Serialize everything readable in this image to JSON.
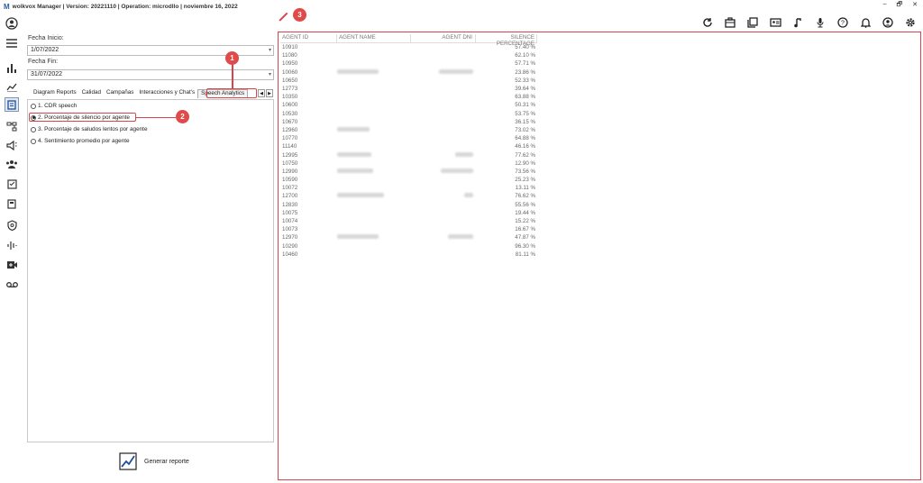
{
  "window": {
    "logo": "M",
    "title": "wolkvox Manager  | Version: 20221110 |  Operation: microdllo | noviembre 16, 2022",
    "controls": [
      "–",
      "🗗",
      "✕"
    ]
  },
  "toolbar": {
    "icons": [
      "refresh-icon",
      "toolbox-icon",
      "book-icon",
      "contact-card-icon",
      "music-note-icon",
      "microphone-icon",
      "help-icon",
      "bell-icon",
      "user-icon",
      "settings-icon"
    ]
  },
  "sidebar": {
    "icons": [
      "user-icon",
      "menu-icon",
      "bar-chart-icon",
      "trend-icon",
      "report-icon",
      "hierarchy-icon",
      "campaign-icon",
      "group-icon",
      "checklist-icon",
      "calculator-icon",
      "shield-icon",
      "audio-wave-icon",
      "video-icon",
      "voicemail-icon"
    ]
  },
  "filters": {
    "start_label": "Fecha Inicio:",
    "start_value": "1/07/2022",
    "end_label": "Fecha Fin:",
    "end_value": "31/07/2022"
  },
  "tabs": [
    "Diagram Reports",
    "Calidad",
    "Campañas",
    "Interacciones y Chat's",
    "Speech Analytics"
  ],
  "selected_tab": "Speech Analytics",
  "reports": [
    {
      "label": "1. CDR speech",
      "selected": false
    },
    {
      "label": "2. Porcentaje de silencio por agente",
      "selected": true
    },
    {
      "label": "3. Porcentaje de saludos lentos por agente",
      "selected": false
    },
    {
      "label": "4. Sentimiento promedio por agente",
      "selected": false
    }
  ],
  "generate_label": "Generar reporte",
  "table": {
    "headers": [
      "AGENT ID",
      "AGENT NAME",
      "AGENT DNI",
      "SILENCE PERCENTAGE"
    ],
    "rows": [
      [
        "10910",
        "57.40 %"
      ],
      [
        "11080",
        "62.10 %"
      ],
      [
        "10950",
        "57.71 %"
      ],
      [
        "10060",
        "23.86 %"
      ],
      [
        "10650",
        "52.33 %"
      ],
      [
        "12773",
        "39.64 %"
      ],
      [
        "10350",
        "63.88 %"
      ],
      [
        "10600",
        "50.31 %"
      ],
      [
        "10530",
        "53.75 %"
      ],
      [
        "10670",
        "36.15 %"
      ],
      [
        "12960",
        "73.02 %"
      ],
      [
        "10770",
        "64.88 %"
      ],
      [
        "11140",
        "46.16 %"
      ],
      [
        "12995",
        "77.62 %"
      ],
      [
        "10750",
        "12.90 %"
      ],
      [
        "12990",
        "73.56 %"
      ],
      [
        "10590",
        "25.23 %"
      ],
      [
        "10072",
        "13.11 %"
      ],
      [
        "12700",
        "76.62 %"
      ],
      [
        "12830",
        "55.56 %"
      ],
      [
        "10075",
        "19.44 %"
      ],
      [
        "10074",
        "15.22 %"
      ],
      [
        "10073",
        "16.67 %"
      ],
      [
        "12970",
        "47.87 %"
      ],
      [
        "10290",
        "96.30 %"
      ],
      [
        "10460",
        "81.11 %"
      ]
    ]
  },
  "callouts": [
    "1",
    "2",
    "3"
  ]
}
